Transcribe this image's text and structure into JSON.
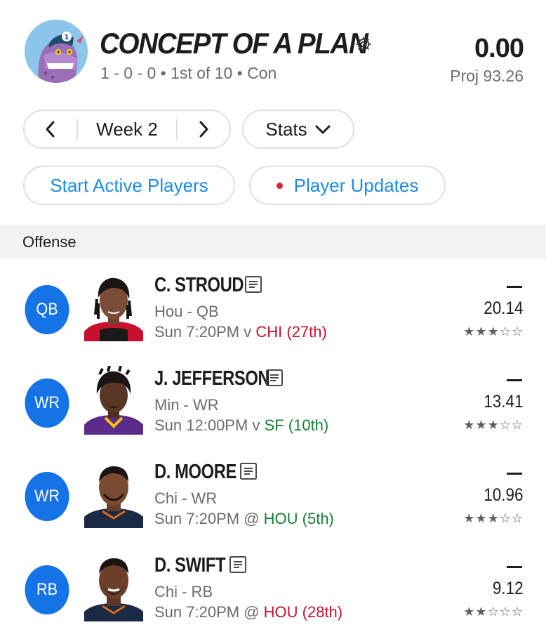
{
  "header": {
    "team_name": "CONCEPT OF A PLAN",
    "record": "1 - 0 - 0 • 1st of 10 • Con",
    "score": "0.00",
    "projection": "Proj 93.26"
  },
  "controls": {
    "week_label": "Week 2",
    "stats_label": "Stats",
    "start_active_label": "Start Active Players",
    "player_updates_label": "Player Updates"
  },
  "section": {
    "label": "Offense"
  },
  "players": [
    {
      "position": "QB",
      "name": "C. STROUD",
      "team_pos": "Hou - QB",
      "game_prefix": "Sun 7:20PM v ",
      "opponent": "CHI (27th)",
      "opponent_tone": "red",
      "points": "20.14",
      "stars_filled": "★★★",
      "stars_empty": "☆☆",
      "star_rating": 3
    },
    {
      "position": "WR",
      "name": "J. JEFFERSON",
      "team_pos": "Min - WR",
      "game_prefix": "Sun 12:00PM v ",
      "opponent": "SF (10th)",
      "opponent_tone": "green",
      "points": "13.41",
      "stars_filled": "★★★",
      "stars_empty": "☆☆",
      "star_rating": 3
    },
    {
      "position": "WR",
      "name": "D. MOORE",
      "team_pos": "Chi - WR",
      "game_prefix": "Sun 7:20PM @ ",
      "opponent": "HOU (5th)",
      "opponent_tone": "green",
      "points": "10.96",
      "stars_filled": "★★★",
      "stars_empty": "☆☆",
      "star_rating": 3
    },
    {
      "position": "RB",
      "name": "D. SWIFT",
      "team_pos": "Chi - RB",
      "game_prefix": "Sun 7:20PM @ ",
      "opponent": "HOU (28th)",
      "opponent_tone": "red",
      "points": "9.12",
      "stars_filled": "★★",
      "stars_empty": "☆☆☆",
      "star_rating": 2
    }
  ],
  "colors": {
    "accent_blue": "#1573e6",
    "link_blue": "#1a8ce8",
    "bad_matchup_red": "#c8102e",
    "good_matchup_green": "#138035",
    "alert_dot": "#e01e3c"
  },
  "icons": {
    "settings": "gear-icon",
    "prev_week": "chevron-left-icon",
    "next_week": "chevron-right-icon",
    "stats_dropdown": "chevron-down-icon",
    "player_note": "notes-icon"
  }
}
